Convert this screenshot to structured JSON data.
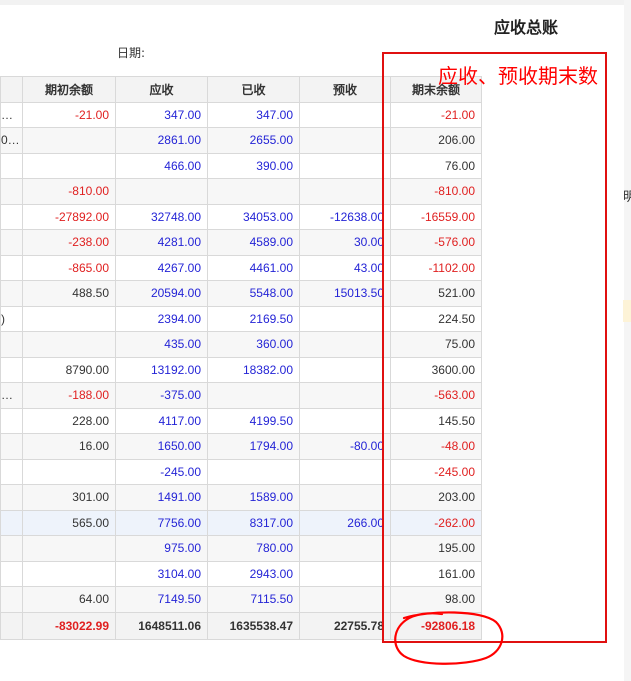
{
  "page": {
    "title": "应收总账",
    "date_label": "日期:",
    "side_fragment": "明"
  },
  "table": {
    "headers": [
      "",
      "期初余额",
      "应收",
      "已收",
      "预收",
      "期末余额"
    ],
    "rows": [
      {
        "first": "…",
        "cells": [
          [
            "-21.00",
            "neg"
          ],
          [
            "347.00",
            "blue"
          ],
          [
            "347.00",
            "blue"
          ],
          [
            "",
            ""
          ],
          [
            "-21.00",
            "neg"
          ]
        ]
      },
      {
        "first": "0…",
        "cells": [
          [
            "",
            ""
          ],
          [
            "2861.00",
            "blue"
          ],
          [
            "2655.00",
            "blue"
          ],
          [
            "",
            ""
          ],
          [
            "206.00",
            "blk"
          ]
        ]
      },
      {
        "first": "",
        "cells": [
          [
            "",
            ""
          ],
          [
            "466.00",
            "blue"
          ],
          [
            "390.00",
            "blue"
          ],
          [
            "",
            ""
          ],
          [
            "76.00",
            "blk"
          ]
        ]
      },
      {
        "first": "",
        "cells": [
          [
            "-810.00",
            "neg"
          ],
          [
            "",
            ""
          ],
          [
            "",
            ""
          ],
          [
            "",
            ""
          ],
          [
            "-810.00",
            "neg"
          ]
        ]
      },
      {
        "first": "",
        "cells": [
          [
            "-27892.00",
            "neg"
          ],
          [
            "32748.00",
            "blue"
          ],
          [
            "34053.00",
            "blue"
          ],
          [
            "-12638.00",
            "blue"
          ],
          [
            "-16559.00",
            "neg"
          ]
        ]
      },
      {
        "first": "",
        "cells": [
          [
            "-238.00",
            "neg"
          ],
          [
            "4281.00",
            "blue"
          ],
          [
            "4589.00",
            "blue"
          ],
          [
            "30.00",
            "blue"
          ],
          [
            "-576.00",
            "neg"
          ]
        ]
      },
      {
        "first": "",
        "cells": [
          [
            "-865.00",
            "neg"
          ],
          [
            "4267.00",
            "blue"
          ],
          [
            "4461.00",
            "blue"
          ],
          [
            "43.00",
            "blue"
          ],
          [
            "-1102.00",
            "neg"
          ]
        ]
      },
      {
        "first": "",
        "cells": [
          [
            "488.50",
            "blk"
          ],
          [
            "20594.00",
            "blue"
          ],
          [
            "5548.00",
            "blue"
          ],
          [
            "15013.50",
            "blue"
          ],
          [
            "521.00",
            "blk"
          ]
        ]
      },
      {
        "first": ")",
        "cells": [
          [
            "",
            ""
          ],
          [
            "2394.00",
            "blue"
          ],
          [
            "2169.50",
            "blue"
          ],
          [
            "",
            ""
          ],
          [
            "224.50",
            "blk"
          ]
        ]
      },
      {
        "first": "",
        "cells": [
          [
            "",
            ""
          ],
          [
            "435.00",
            "blue"
          ],
          [
            "360.00",
            "blue"
          ],
          [
            "",
            ""
          ],
          [
            "75.00",
            "blk"
          ]
        ]
      },
      {
        "first": "",
        "cells": [
          [
            "8790.00",
            "blk"
          ],
          [
            "13192.00",
            "blue"
          ],
          [
            "18382.00",
            "blue"
          ],
          [
            "",
            ""
          ],
          [
            "3600.00",
            "blk"
          ]
        ]
      },
      {
        "first": "…",
        "cells": [
          [
            "-188.00",
            "neg"
          ],
          [
            "-375.00",
            "blue"
          ],
          [
            "",
            ""
          ],
          [
            "",
            ""
          ],
          [
            "-563.00",
            "neg"
          ]
        ]
      },
      {
        "first": "",
        "cells": [
          [
            "228.00",
            "blk"
          ],
          [
            "4117.00",
            "blue"
          ],
          [
            "4199.50",
            "blue"
          ],
          [
            "",
            ""
          ],
          [
            "145.50",
            "blk"
          ]
        ]
      },
      {
        "first": "",
        "cells": [
          [
            "16.00",
            "blk"
          ],
          [
            "1650.00",
            "blue"
          ],
          [
            "1794.00",
            "blue"
          ],
          [
            "-80.00",
            "blue"
          ],
          [
            "-48.00",
            "neg"
          ]
        ]
      },
      {
        "first": "",
        "cells": [
          [
            "",
            ""
          ],
          [
            "-245.00",
            "blue"
          ],
          [
            "",
            ""
          ],
          [
            "",
            ""
          ],
          [
            "-245.00",
            "neg"
          ]
        ]
      },
      {
        "first": "",
        "cells": [
          [
            "301.00",
            "blk"
          ],
          [
            "1491.00",
            "blue"
          ],
          [
            "1589.00",
            "blue"
          ],
          [
            "",
            ""
          ],
          [
            "203.00",
            "blk"
          ]
        ]
      },
      {
        "first": "",
        "cells": [
          [
            "565.00",
            "blk"
          ],
          [
            "7756.00",
            "blue"
          ],
          [
            "8317.00",
            "blue"
          ],
          [
            "266.00",
            "blue"
          ],
          [
            "-262.00",
            "neg"
          ]
        ]
      },
      {
        "first": "",
        "cells": [
          [
            "",
            ""
          ],
          [
            "975.00",
            "blue"
          ],
          [
            "780.00",
            "blue"
          ],
          [
            "",
            ""
          ],
          [
            "195.00",
            "blk"
          ]
        ]
      },
      {
        "first": "",
        "cells": [
          [
            "",
            ""
          ],
          [
            "3104.00",
            "blue"
          ],
          [
            "2943.00",
            "blue"
          ],
          [
            "",
            ""
          ],
          [
            "161.00",
            "blk"
          ]
        ]
      },
      {
        "first": "",
        "cells": [
          [
            "64.00",
            "blk"
          ],
          [
            "7149.50",
            "blue"
          ],
          [
            "7115.50",
            "blue"
          ],
          [
            "",
            ""
          ],
          [
            "98.00",
            "blk"
          ]
        ]
      }
    ],
    "total": {
      "first": "",
      "cells": [
        [
          "-83022.99",
          "neg"
        ],
        [
          "1648511.06",
          "blk"
        ],
        [
          "1635538.47",
          "blk"
        ],
        [
          "22755.78",
          "blk"
        ],
        [
          "-92806.18",
          "neg"
        ]
      ]
    }
  },
  "annotation": {
    "label": "应收、预收期末数",
    "color": "#ff0000"
  },
  "colors": {
    "negative": "#e02020",
    "link_blue": "#2424d6",
    "header_bg": "#f3f3f3",
    "annotation": "#ff0000"
  }
}
